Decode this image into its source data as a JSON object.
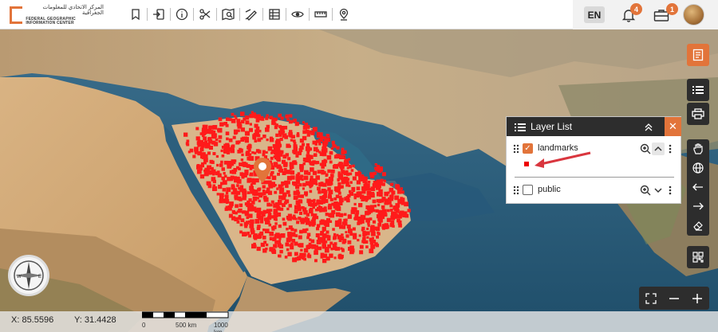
{
  "header": {
    "logo_ar": "المركز الاتحادي للمعلومات الجغرافية",
    "logo_en": "FEDERAL GEOGRAPHIC INFORMATION CENTER",
    "toolbar_icons": [
      "bookmark-icon",
      "sign-in-icon",
      "info-icon",
      "scissors-icon",
      "map-search-icon",
      "draw-icon",
      "table-icon",
      "eye-icon",
      "ruler-icon",
      "location-pin-icon"
    ],
    "language": "EN",
    "notifications_count": "4",
    "briefcase_count": "1"
  },
  "layer_panel": {
    "title": "Layer List",
    "layers": [
      {
        "name": "landmarks",
        "checked": true,
        "legend_color": "#e00000"
      },
      {
        "name": "public",
        "checked": false
      }
    ]
  },
  "coords": {
    "x": "X: 85.5596",
    "y": "Y: 31.4428"
  },
  "scale": {
    "labels": [
      "0",
      "500 km",
      "1000 km"
    ]
  },
  "colors": {
    "accent": "#e2743a",
    "dark": "#2d2d2d",
    "feature": "#ff1a1a"
  }
}
